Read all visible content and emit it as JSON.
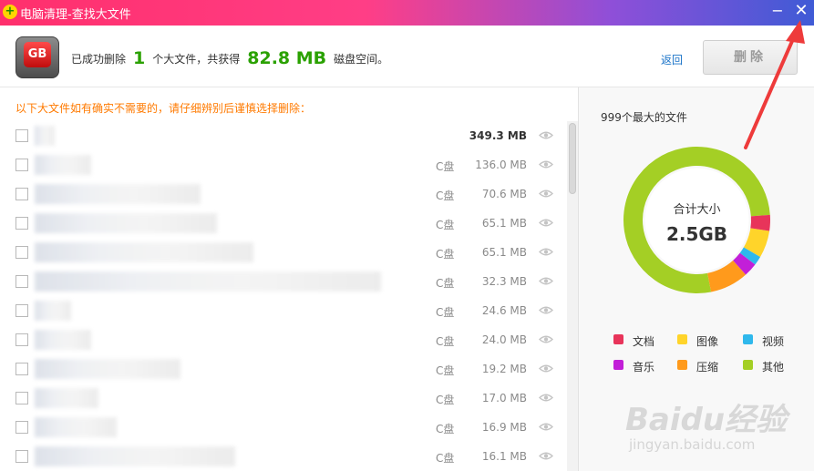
{
  "window": {
    "title": "电脑清理-查找大文件",
    "minimize_glyph": "−",
    "close_glyph": "✕"
  },
  "summary": {
    "prefix": "已成功删除",
    "count": "1",
    "mid": "个大文件，共获得",
    "freed": "82.8 MB",
    "suffix": "磁盘空间。",
    "back_label": "返回",
    "delete_label": "删除",
    "icon_label": "GB"
  },
  "notice": "以下大文件如有确实不需要的，请仔细辨别后谨慎选择删除：",
  "files": [
    {
      "drive": "",
      "size": "349.3 MB",
      "bold": true
    },
    {
      "drive": "C盘",
      "size": "136.0 MB"
    },
    {
      "drive": "C盘",
      "size": "70.6 MB"
    },
    {
      "drive": "C盘",
      "size": "65.1 MB"
    },
    {
      "drive": "C盘",
      "size": "65.1 MB"
    },
    {
      "drive": "C盘",
      "size": "32.3 MB"
    },
    {
      "drive": "C盘",
      "size": "24.6 MB"
    },
    {
      "drive": "C盘",
      "size": "24.0 MB"
    },
    {
      "drive": "C盘",
      "size": "19.2 MB"
    },
    {
      "drive": "C盘",
      "size": "17.0 MB"
    },
    {
      "drive": "C盘",
      "size": "16.9 MB"
    },
    {
      "drive": "C盘",
      "size": "16.1 MB"
    }
  ],
  "stats": {
    "title": "999个最大的文件",
    "total_label": "合计大小",
    "total_value": "2.5GB",
    "legend": [
      {
        "label": "文档",
        "color": "#e8345a"
      },
      {
        "label": "图像",
        "color": "#ffd42a"
      },
      {
        "label": "视频",
        "color": "#2fb8ec"
      },
      {
        "label": "音乐",
        "color": "#c21fd8"
      },
      {
        "label": "压缩",
        "color": "#ff9a1c"
      },
      {
        "label": "其他",
        "color": "#a4cf25"
      }
    ],
    "segments": [
      {
        "type": "文档",
        "fraction": 0.035
      },
      {
        "type": "图像",
        "fraction": 0.06
      },
      {
        "type": "视频",
        "fraction": 0.02
      },
      {
        "type": "音乐",
        "fraction": 0.03
      },
      {
        "type": "压缩",
        "fraction": 0.085
      },
      {
        "type": "其他",
        "fraction": 0.77
      }
    ]
  },
  "watermark": {
    "text": "Baidu经验",
    "sub": "jingyan.baidu.com"
  },
  "colors": {
    "accent_green": "#2aa100",
    "notice_orange": "#ff7a00",
    "link_blue": "#1a73c8",
    "annotation_red": "#ee3b3b"
  }
}
